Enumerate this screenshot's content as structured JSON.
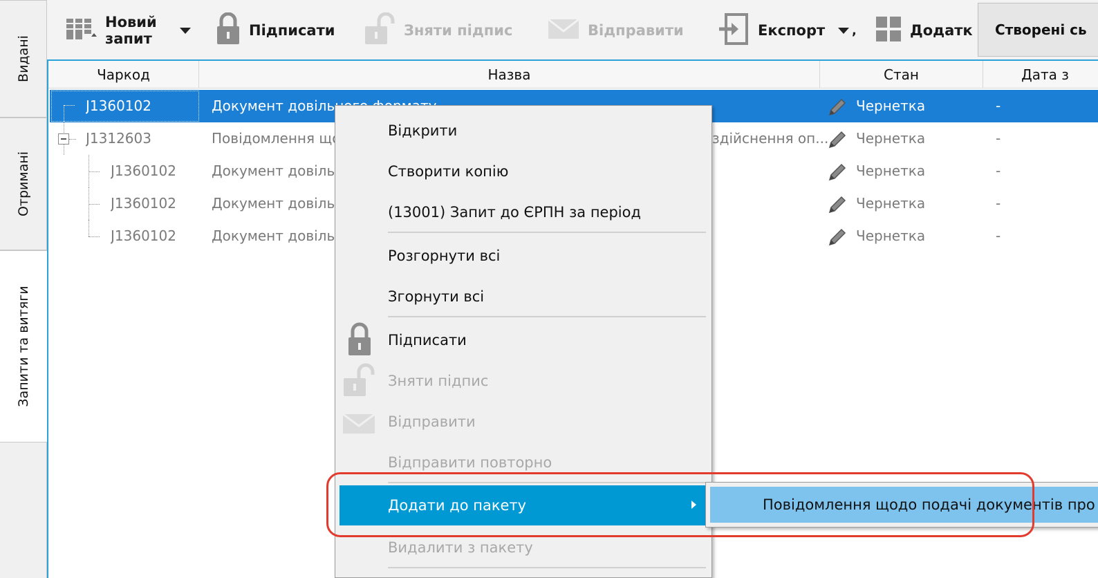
{
  "left_tabs": [
    {
      "label": "Видані"
    },
    {
      "label": "Отримані"
    },
    {
      "label": "Запити та витяги"
    }
  ],
  "toolbar": {
    "new_request_line1": "Новий",
    "new_request_line2": "запит",
    "sign": "Підписати",
    "remove_sign": "Зняти підпис",
    "send": "Відправити",
    "export": "Експорт",
    "additional": "Додатк",
    "created_tab": "Створені сь"
  },
  "grid": {
    "columns": [
      "Чаркод",
      "Назва",
      "Стан",
      "Дата з"
    ],
    "rows": [
      {
        "code": "J1360102",
        "name": "Документ довільного формату",
        "status": "Чернетка",
        "date": "-",
        "selected": true
      },
      {
        "code": "J1312603",
        "name": "Повідомлення щод",
        "name_tail": "здійснення оп...",
        "status": "Чернетка",
        "date": "-"
      },
      {
        "code": "J1360102",
        "name": "Документ довільн",
        "status": "Чернетка",
        "date": "-"
      },
      {
        "code": "J1360102",
        "name": "Документ довільн",
        "status": "Чернетка",
        "date": "-"
      },
      {
        "code": "J1360102",
        "name": "Документ довільн",
        "status": "Чернетка",
        "date": "-"
      }
    ]
  },
  "context_menu": {
    "open": "Відкрити",
    "create_copy": "Створити копію",
    "request_erpn": "(13001) Запит до ЄРПН за період",
    "expand_all": "Розгорнути всі",
    "collapse_all": "Згорнути всі",
    "sign": "Підписати",
    "remove_sign": "Зняти підпис",
    "send": "Відправити",
    "resend": "Відправити повторно",
    "add_to_package": "Додати до пакету",
    "remove_from_package": "Видалити з пакету"
  },
  "submenu": {
    "item": "Повідомлення щодо подачі документів про"
  },
  "colors": {
    "selection": "#1b7fd6",
    "menu_highlight": "#0099d4",
    "submenu_highlight": "#7ec3ee",
    "annotation_red": "#e23b2e"
  }
}
